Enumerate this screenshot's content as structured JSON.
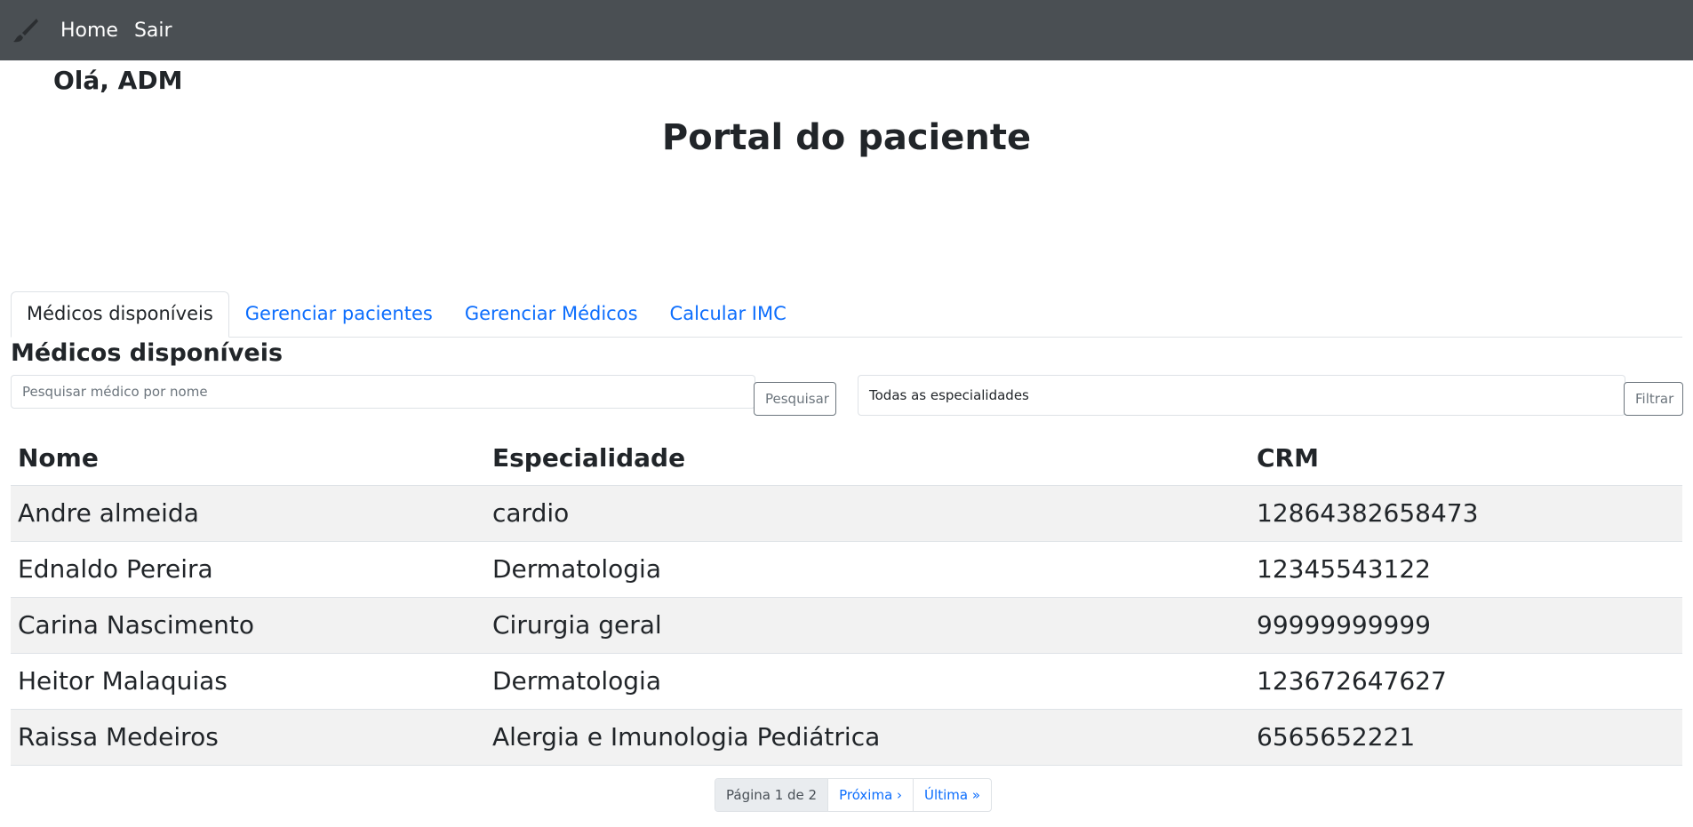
{
  "navbar": {
    "brand_icon": "paintbrush-icon",
    "links": [
      {
        "label": "Home"
      },
      {
        "label": "Sair"
      }
    ],
    "bg_color": "#4a4f53"
  },
  "greeting": "Olá, ADM",
  "page_title": "Portal do paciente",
  "tabs": [
    {
      "label": "Médicos disponíveis",
      "active": true
    },
    {
      "label": "Gerenciar pacientes",
      "active": false
    },
    {
      "label": "Gerenciar Médicos",
      "active": false
    },
    {
      "label": "Calcular IMC",
      "active": false
    }
  ],
  "section_title": "Médicos disponíveis",
  "search": {
    "placeholder": "Pesquisar médico por nome",
    "value": "",
    "button_label": "Pesquisar"
  },
  "filter": {
    "selected": "Todas as especialidades",
    "button_label": "Filtrar"
  },
  "table": {
    "headers": [
      "Nome",
      "Especialidade",
      "CRM"
    ],
    "rows": [
      [
        "Andre almeida",
        "cardio",
        "12864382658473"
      ],
      [
        "Ednaldo Pereira",
        "Dermatologia",
        "12345543122"
      ],
      [
        "Carina Nascimento",
        "Cirurgia geral",
        "99999999999"
      ],
      [
        "Heitor Malaquias",
        "Dermatologia",
        "123672647627"
      ],
      [
        "Raissa Medeiros",
        "Alergia e Imunologia Pediátrica",
        "6565652221"
      ]
    ]
  },
  "pagination": {
    "current": "Página 1 de 2",
    "next": "Próxima ›",
    "last": "Última »"
  },
  "colors": {
    "link": "#0d6efd",
    "stripe": "#f2f2f2"
  }
}
